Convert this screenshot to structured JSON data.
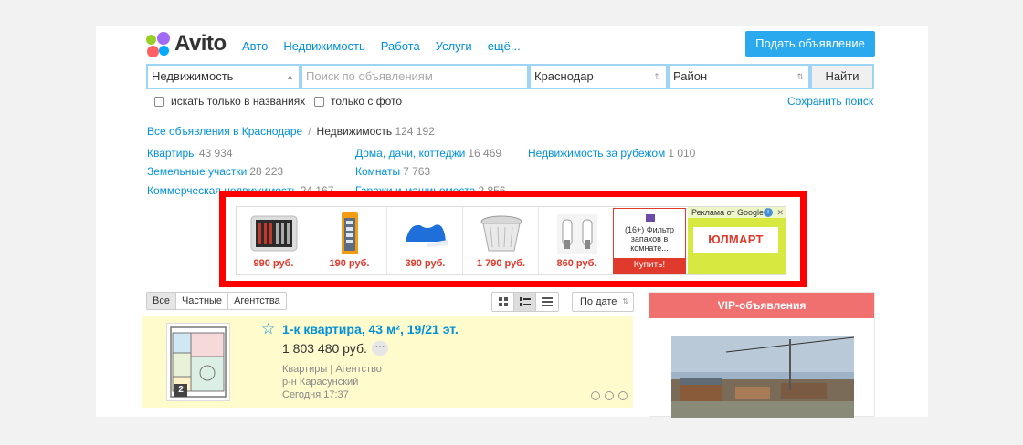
{
  "header": {
    "logo_text": "Avito",
    "nav": [
      "Авто",
      "Недвижимость",
      "Работа",
      "Услуги",
      "ещё..."
    ],
    "post_button": "Подать объявление"
  },
  "search": {
    "category": "Недвижимость",
    "query_placeholder": "Поиск по объявлениям",
    "city": "Краснодар",
    "district": "Район",
    "find_button": "Найти",
    "option_titles_only": "искать только в названиях",
    "option_with_photo": "только с фото",
    "save_search": "Сохранить поиск"
  },
  "breadcrumbs": {
    "root": "Все объявления в Краснодаре",
    "separator": "/",
    "current": "Недвижимость",
    "current_count": "124 192"
  },
  "categories": [
    {
      "label": "Квартиры",
      "count": "43 934"
    },
    {
      "label": "Дома, дачи, коттеджи",
      "count": "16 469"
    },
    {
      "label": "Недвижимость за рубежом",
      "count": "1 010"
    },
    {
      "label": "Земельные участки",
      "count": "28 223"
    },
    {
      "label": "Комнаты",
      "count": "7 763"
    },
    {
      "label": "Коммерческая недвижимость",
      "count": "24 167"
    },
    {
      "label": "Гаражи и машиноместа",
      "count": "2 856"
    }
  ],
  "ad": {
    "products": [
      {
        "price": "990 руб.",
        "icon": "tool-case-icon"
      },
      {
        "price": "190 руб.",
        "icon": "razor-pack-icon"
      },
      {
        "price": "390 руб.",
        "icon": "foam-pillow-icon"
      },
      {
        "price": "1 790 руб.",
        "icon": "laundry-basket-icon"
      },
      {
        "price": "860 руб.",
        "icon": "car-bulbs-icon"
      }
    ],
    "promo_text": "(16+) Фильтр запахов в комнате...",
    "promo_button": "Купить!",
    "google_label": "Реклама от Google",
    "google_close": "✕",
    "google_info": "i",
    "brand": "ЮЛМАРТ",
    "highlight_color": "#ff0000"
  },
  "filters": {
    "seller_tabs": [
      "Все",
      "Частные",
      "Агентства"
    ],
    "active_seller_tab": "Все",
    "view_icons": [
      "grid-view-icon",
      "list-view-icon",
      "compact-view-icon"
    ],
    "sort": "По дате"
  },
  "listing": {
    "title": "1-к квартира, 43 м², 19/21 эт.",
    "price": "1 803 480 руб.",
    "more": "···",
    "category": "Квартиры",
    "seller": "Агентство",
    "district": "р-н Карасунский",
    "date": "Сегодня 17:37",
    "rooms_badge": "2",
    "star": "☆"
  },
  "vip": {
    "title": "VIP-объявления"
  }
}
